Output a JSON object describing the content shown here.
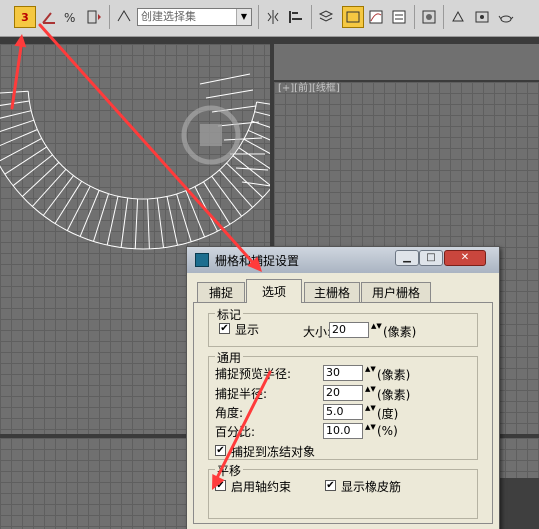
{
  "toolbar": {
    "snap_label": "3",
    "selection_set_placeholder": "创建选择集",
    "dropdown_arrow": "▼"
  },
  "viewport": {
    "label": "[+][前][线框]"
  },
  "dialog": {
    "title": "栅格和捕捉设置",
    "minimize": "▁",
    "maximize": "□",
    "close": "✕",
    "tabs": [
      {
        "label": "捕捉"
      },
      {
        "label": "选项"
      },
      {
        "label": "主栅格"
      },
      {
        "label": "用户栅格"
      }
    ],
    "markers": {
      "title": "标记",
      "display_label": "显示",
      "display_checked": true,
      "size_label": "大小:",
      "size_value": "20",
      "size_unit": "(像素)"
    },
    "general": {
      "title": "通用",
      "preview_radius_label": "捕捉预览半径:",
      "preview_radius_value": "30",
      "preview_radius_unit": "(像素)",
      "snap_radius_label": "捕捉半径:",
      "snap_radius_value": "20",
      "snap_radius_unit": "(像素)",
      "angle_label": "角度:",
      "angle_value": "5.0",
      "angle_unit": "(度)",
      "percent_label": "百分比:",
      "percent_value": "10.0",
      "percent_unit": "(%)",
      "frozen_label": "捕捉到冻结对象",
      "frozen_checked": true
    },
    "translation": {
      "title": "平移",
      "axis_constraint_label": "启用轴约束",
      "axis_constraint_checked": true,
      "rubber_band_label": "显示橡皮筋",
      "rubber_band_checked": true
    }
  },
  "check_glyph": "✔",
  "spinner_glyph": "▲▼",
  "colors": {
    "active_button": "#f5c842",
    "annotation_arrow": "#ff3b3b",
    "close_button": "#c9463d"
  }
}
